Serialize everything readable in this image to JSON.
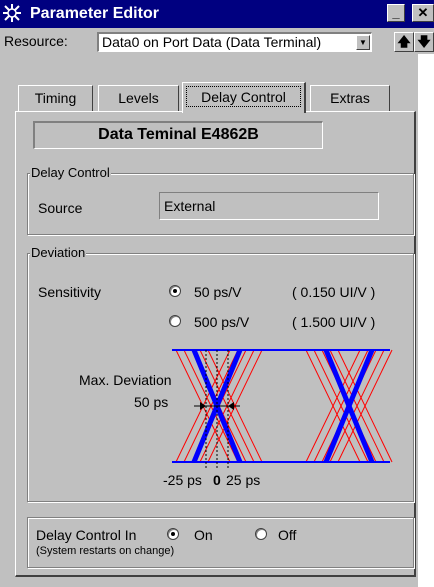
{
  "window": {
    "title": "Parameter Editor",
    "minimize_label": "_",
    "close_label": "✕"
  },
  "resource": {
    "label": "Resource:",
    "value": "Data0 on Port Data (Data Terminal)",
    "up_label": "🡅",
    "down_label": "🡇"
  },
  "tabs": [
    {
      "label": "Timing",
      "active": false
    },
    {
      "label": "Levels",
      "active": false
    },
    {
      "label": "Delay Control",
      "active": true
    },
    {
      "label": "Extras",
      "active": false
    }
  ],
  "device_name": "Data Teminal E4862B",
  "delay_control": {
    "legend": "Delay Control",
    "source_label": "Source",
    "source_value": "External"
  },
  "deviation": {
    "legend": "Deviation",
    "sensitivity_label": "Sensitivity",
    "options": [
      {
        "label": "50 ps/V",
        "ui": "( 0.150 UI/V )",
        "selected": true
      },
      {
        "label": "500 ps/V",
        "ui": "( 1.500 UI/V )",
        "selected": false
      }
    ],
    "max_deviation_label": "Max. Deviation",
    "max_deviation_value": "50 ps",
    "tick_minus": "-25 ps",
    "tick_zero": "0",
    "tick_plus": "25 ps"
  },
  "delay_control_in": {
    "label": "Delay Control In",
    "options": [
      {
        "label": "On",
        "selected": true
      },
      {
        "label": "Off",
        "selected": false
      }
    ],
    "note": "(System restarts on change)"
  },
  "colors": {
    "title_bar": "#000080",
    "face": "#c0c0c0",
    "eye_blue": "#0000ff",
    "eye_red": "#ff0000"
  }
}
